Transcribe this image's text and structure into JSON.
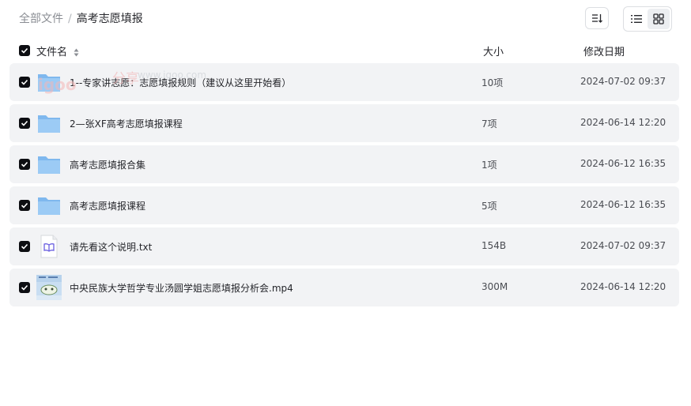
{
  "breadcrumb": {
    "root": "全部文件",
    "separator": "/",
    "current": "高考志愿填报"
  },
  "columns": {
    "name": "文件名",
    "size": "大小",
    "date": "修改日期"
  },
  "files": [
    {
      "name": "1--专家讲志愿：志愿填报规则（建议从这里开始看）",
      "size": "10项",
      "date": "2024-07-02 09:37",
      "type": "folder"
    },
    {
      "name": "2—张XF高考志愿填报课程",
      "size": "7项",
      "date": "2024-06-14 12:20",
      "type": "folder"
    },
    {
      "name": "高考志愿填报合集",
      "size": "1项",
      "date": "2024-06-12 16:35",
      "type": "folder"
    },
    {
      "name": "高考志愿填报课程",
      "size": "5项",
      "date": "2024-06-12 16:35",
      "type": "folder"
    },
    {
      "name": "请先看这个说明.txt",
      "size": "154B",
      "date": "2024-07-02 09:37",
      "type": "txt"
    },
    {
      "name": "中央民族大学哲学专业汤圆学姐志愿填报分析会.mp4",
      "size": "300M",
      "date": "2024-06-14 12:20",
      "type": "video"
    }
  ],
  "watermark": {
    "text1": "分享",
    "text2": "www.igoo.com",
    "logo": "igoo"
  },
  "icons": {
    "sort": "sort-icon",
    "list_view": "list-view-icon",
    "grid_view": "grid-view-icon",
    "check": "checkbox-icon",
    "folder": "folder-icon",
    "txt": "document-icon",
    "video": "video-thumbnail"
  },
  "colors": {
    "row_bg": "#f2f3f5",
    "checkbox": "#0d0e12",
    "folder": "#7fb8ee",
    "doc_accent": "#6a5fe0"
  }
}
